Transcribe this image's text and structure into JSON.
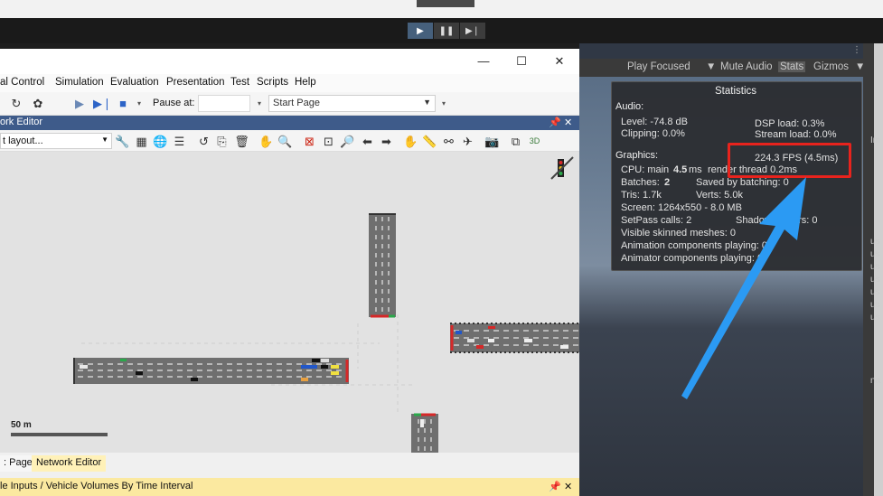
{
  "unity": {
    "play_icon": "play-icon",
    "pause_icon": "pause-icon",
    "step_icon": "step-icon",
    "toolbar": {
      "play_focused": "Play Focused",
      "mute_audio": "Mute Audio",
      "stats": "Stats",
      "gizmos": "Gizmos"
    },
    "right_labels": [
      "Im",
      "us",
      "us",
      "us",
      "us",
      "us",
      "us",
      "us",
      "na"
    ]
  },
  "stats": {
    "title": "Statistics",
    "audio_header": "Audio:",
    "level": "Level: -74.8 dB",
    "dsp_load": "DSP load: 0.3%",
    "clipping": "Clipping: 0.0%",
    "stream_load": "Stream load: 0.0%",
    "graphics_header": "Graphics:",
    "fps": "224.3 FPS (4.5ms)",
    "cpu_main_label": "CPU: main",
    "cpu_main_value": "4.5",
    "cpu_main_unit": "ms",
    "render_thread": "render thread 0.2ms",
    "batches_label": "Batches:",
    "batches_value": "2",
    "saved_by_batching": "Saved by batching: 0",
    "tris": "Tris: 1.7k",
    "verts": "Verts: 5.0k",
    "screen": "Screen: 1264x550 - 8.0 MB",
    "setpass": "SetPass calls: 2",
    "shadow_casters": "Shadow casters: 0",
    "visible_skinned": "Visible skinned meshes: 0",
    "animation_playing": "Animation components playing: 0",
    "animator_playing": "Animator components playing: 0",
    "highlight_color": "#e8231d",
    "arrow_color": "#2b9af3"
  },
  "ptv": {
    "window": {
      "minimize": "—",
      "maximize": "☐",
      "close": "✕"
    },
    "menu": [
      "al Control",
      "Simulation",
      "Evaluation",
      "Presentation",
      "Test",
      "Scripts",
      "Help"
    ],
    "toolbar": {
      "pause_label": "Pause at:",
      "pause_value": "",
      "start_page": "Start Page"
    },
    "network_editor_title": "ork Editor",
    "pin_icon": "pin-icon",
    "close_icon": "close-icon",
    "layout_select": "t layout...",
    "scale_label": "50 m",
    "tabs": {
      "start_page": ": Page",
      "network_editor": "Network Editor"
    },
    "bottom_panel_title": "le Inputs / Vehicle Volumes By Time Interval",
    "accent_color": "#3e5b8a",
    "tab_active_color": "#fff1b8"
  }
}
